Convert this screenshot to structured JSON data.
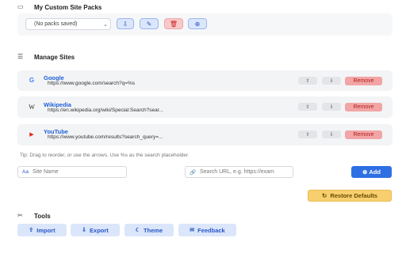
{
  "packs": {
    "title": "My Custom Site Packs",
    "icon": "folder-icon",
    "select_value": "(No packs saved)",
    "actions": [
      {
        "name": "save-pack",
        "icon": "download-icon",
        "glyph": "⇩"
      },
      {
        "name": "edit-pack",
        "icon": "pencil-icon",
        "glyph": "✎"
      },
      {
        "name": "delete-pack",
        "icon": "trash-icon",
        "glyph": "🗑"
      },
      {
        "name": "add-pack",
        "icon": "plus-circle-icon",
        "glyph": "⊕"
      }
    ]
  },
  "manage": {
    "title": "Manage Sites",
    "icon": "list-icon",
    "sites": [
      {
        "name": "Google",
        "url": "https://www.google.com/search?q=%s",
        "favicon": "G",
        "favicon_color": "#4285f4"
      },
      {
        "name": "Wikipedia",
        "url": "https://en.wikipedia.org/wiki/Special:Search?sear...",
        "favicon": "W",
        "favicon_color": "#222222"
      },
      {
        "name": "YouTube",
        "url": "https://www.youtube.com/results?search_query=...",
        "favicon": "▶",
        "favicon_color": "#e62117"
      }
    ],
    "up_glyph": "⇧",
    "down_glyph": "⇩",
    "remove_label": "Remove"
  },
  "tip": "Tip: Drag to reorder, or use the arrows. Use %s as the search placeholder.",
  "add_form": {
    "name_prefix": "Aa",
    "name_placeholder": "Site Name",
    "url_prefix": "🔗",
    "url_placeholder": "Search URL, e.g. https://exam",
    "add_label": "Add",
    "add_icon": "⊕"
  },
  "restore": {
    "label": "Restore Defaults",
    "icon": "↻"
  },
  "tools": {
    "title": "Tools",
    "icon": "tools-icon",
    "buttons": [
      {
        "label": "Import",
        "icon": "upload-icon",
        "glyph": "⇪"
      },
      {
        "label": "Export",
        "icon": "download-icon",
        "glyph": "⇩"
      },
      {
        "label": "Theme",
        "icon": "palette-icon",
        "glyph": "☾"
      },
      {
        "label": "Feedback",
        "icon": "message-icon",
        "glyph": "✉"
      }
    ]
  },
  "colors": {
    "accent": "#2f6fe4",
    "remove": "#f2a5a5",
    "restore": "#f7cf6e"
  }
}
